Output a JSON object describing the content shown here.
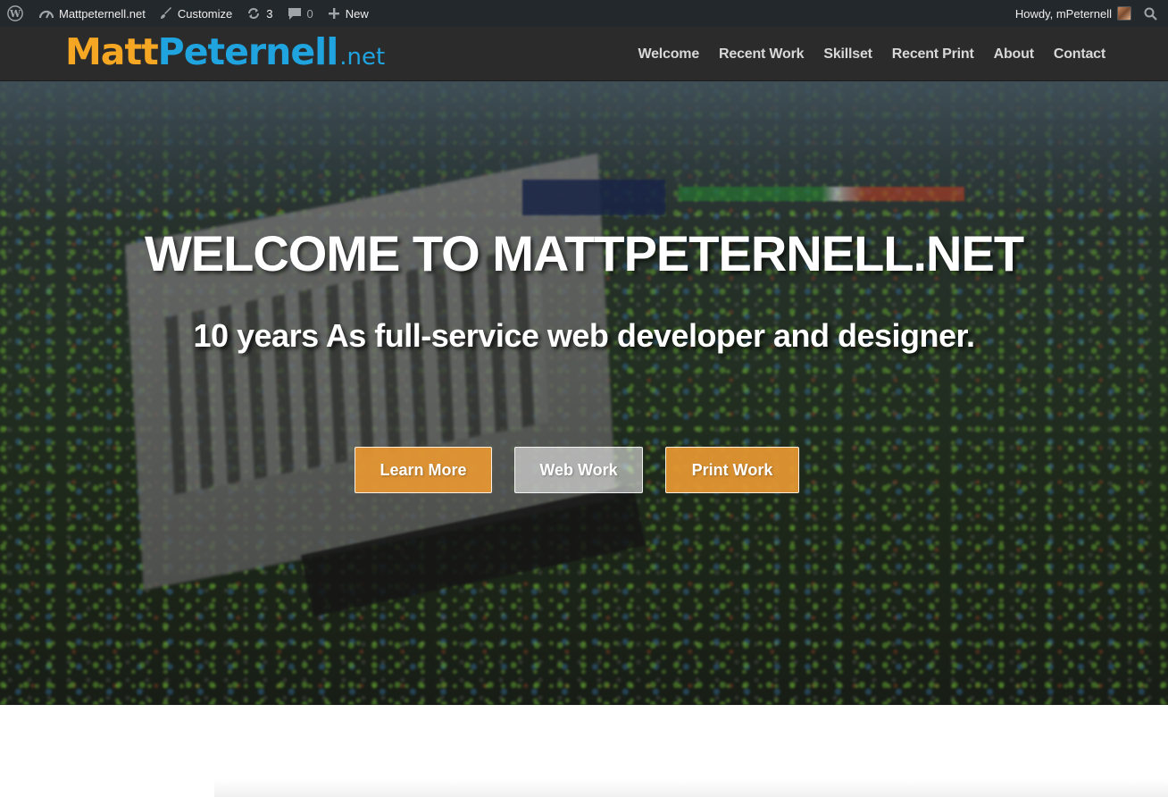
{
  "admin_bar": {
    "site_name": "Mattpeternell.net",
    "customize": "Customize",
    "updates_count": "3",
    "comments_count": "0",
    "new_label": "New",
    "greeting": "Howdy, mPeternell"
  },
  "header": {
    "logo_part1": "Matt",
    "logo_part2": "Peternell",
    "logo_part3": ".net",
    "nav": [
      "Welcome",
      "Recent Work",
      "Skillset",
      "Recent Print",
      "About",
      "Contact"
    ]
  },
  "hero": {
    "title": "WELCOME TO MATTPETERNELL.NET",
    "subtitle": "10 years As full-service web developer and designer.",
    "buttons": [
      "Learn More",
      "Web Work",
      "Print Work"
    ]
  },
  "colors": {
    "admin_bar_bg": "#23282d",
    "header_bg": "#2b2b2b",
    "logo_orange": "#f5a623",
    "logo_blue": "#1fa4e0",
    "button_orange": "#e89832"
  }
}
